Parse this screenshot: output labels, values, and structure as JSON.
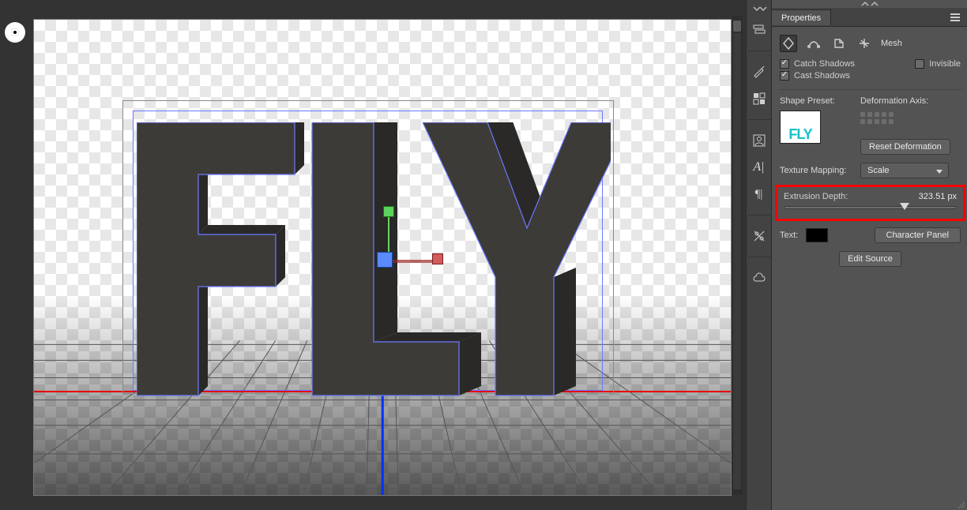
{
  "canvas": {
    "text": "FLY"
  },
  "bottom_status_label": "",
  "panel": {
    "tab": "Properties",
    "mesh_label": "Mesh",
    "checkboxes": {
      "catch_shadows": "Catch Shadows",
      "cast_shadows": "Cast Shadows",
      "invisible": "Invisible"
    },
    "shape_preset_label": "Shape Preset:",
    "deformation_axis_label": "Deformation Axis:",
    "reset_deformation": "Reset Deformation",
    "texture_mapping_label": "Texture Mapping:",
    "texture_mapping_value": "Scale",
    "extrusion_depth_label": "Extrusion Depth:",
    "extrusion_depth_value": "323.51 px",
    "text_label": "Text:",
    "character_panel": "Character Panel",
    "edit_source": "Edit Source",
    "preview_text": "FLY"
  }
}
